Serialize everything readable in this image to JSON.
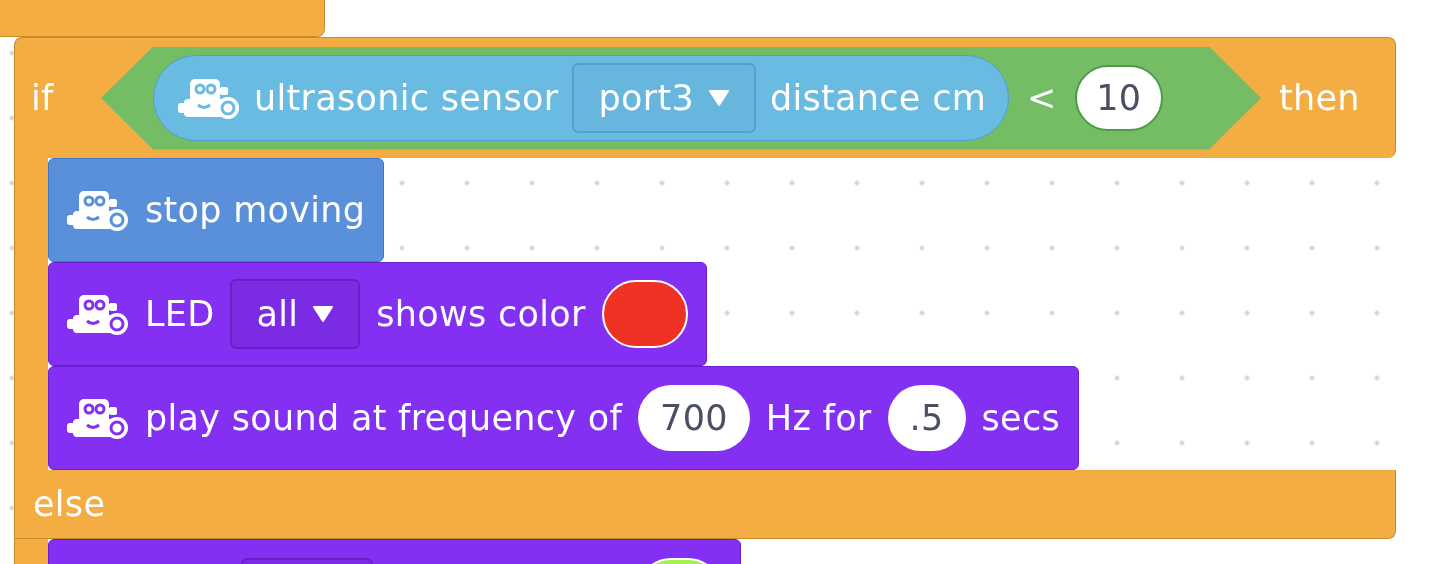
{
  "if_block": {
    "if_label": "if",
    "then_label": "then",
    "else_label": "else",
    "condition": {
      "sensor_label": "ultrasonic sensor",
      "port": "port3",
      "measure": "distance cm",
      "operator": "<",
      "value": "10"
    },
    "then_blocks": [
      {
        "kind": "move",
        "parts": [
          {
            "kind": "text",
            "text": "stop moving"
          }
        ]
      },
      {
        "kind": "light",
        "parts": [
          {
            "kind": "text",
            "text": "LED"
          },
          {
            "kind": "dropdown",
            "text": "all"
          },
          {
            "kind": "text",
            "text": "shows color"
          },
          {
            "kind": "color",
            "color": "#ee3325"
          }
        ]
      },
      {
        "kind": "light",
        "parts": [
          {
            "kind": "text",
            "text": "play sound at frequency of"
          },
          {
            "kind": "number",
            "text": "700"
          },
          {
            "kind": "text",
            "text": "Hz for"
          },
          {
            "kind": "number",
            "text": ".5"
          },
          {
            "kind": "text",
            "text": "secs"
          }
        ]
      }
    ],
    "else_blocks": [
      {
        "kind": "light",
        "parts": [
          {
            "kind": "dropdown"
          },
          {
            "kind": "color",
            "color": "#a4f04c"
          }
        ]
      }
    ]
  }
}
